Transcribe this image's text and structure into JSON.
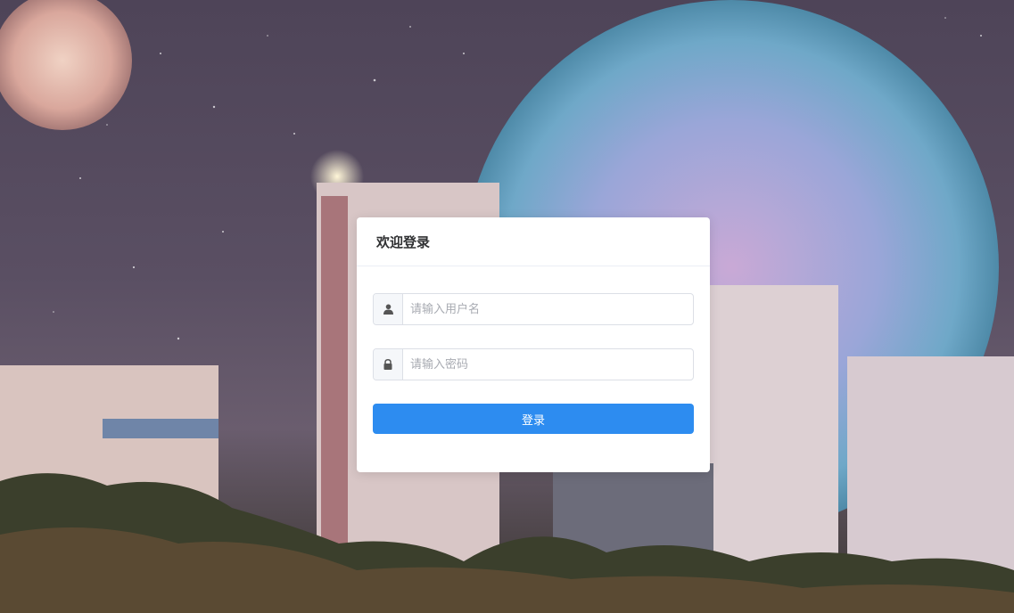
{
  "login": {
    "title": "欢迎登录",
    "username_placeholder": "请输入用户名",
    "username_value": "",
    "password_placeholder": "请输入密码",
    "password_value": "",
    "submit_label": "登录"
  },
  "icons": {
    "username": "user-icon",
    "password": "lock-icon"
  },
  "colors": {
    "primary_button": "#2d8cf0",
    "card_background": "#ffffff",
    "title_text": "#303133"
  }
}
